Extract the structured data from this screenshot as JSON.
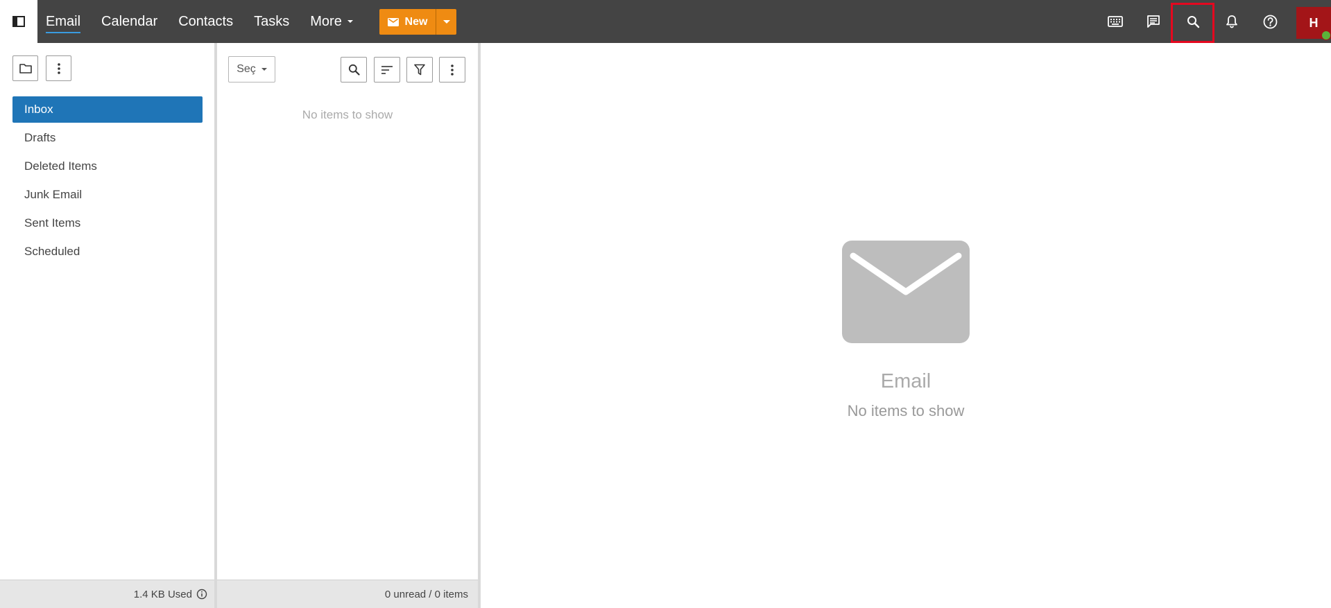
{
  "app": {
    "nav": [
      {
        "label": "Email",
        "active": true
      },
      {
        "label": "Calendar",
        "active": false
      },
      {
        "label": "Contacts",
        "active": false
      },
      {
        "label": "Tasks",
        "active": false
      },
      {
        "label": "More",
        "active": false,
        "has_dropdown": true
      }
    ],
    "new_button": {
      "label": "New"
    },
    "avatar": {
      "initial": "H",
      "presence": "online"
    },
    "colors": {
      "topbar": "#444444",
      "accent": "#ef8b12",
      "selected": "#1f75b7",
      "avatar": "#a31518",
      "annotation": "#e5081f"
    }
  },
  "folders": {
    "items": [
      {
        "label": "Inbox",
        "selected": true
      },
      {
        "label": "Drafts",
        "selected": false
      },
      {
        "label": "Deleted Items",
        "selected": false
      },
      {
        "label": "Junk Email",
        "selected": false
      },
      {
        "label": "Sent Items",
        "selected": false
      },
      {
        "label": "Scheduled",
        "selected": false
      }
    ],
    "storage": "1.4 KB Used"
  },
  "list": {
    "select_label": "Seç",
    "empty_text": "No items to show",
    "status": "0 unread / 0 items"
  },
  "reading": {
    "title": "Email",
    "subtitle": "No items to show"
  }
}
